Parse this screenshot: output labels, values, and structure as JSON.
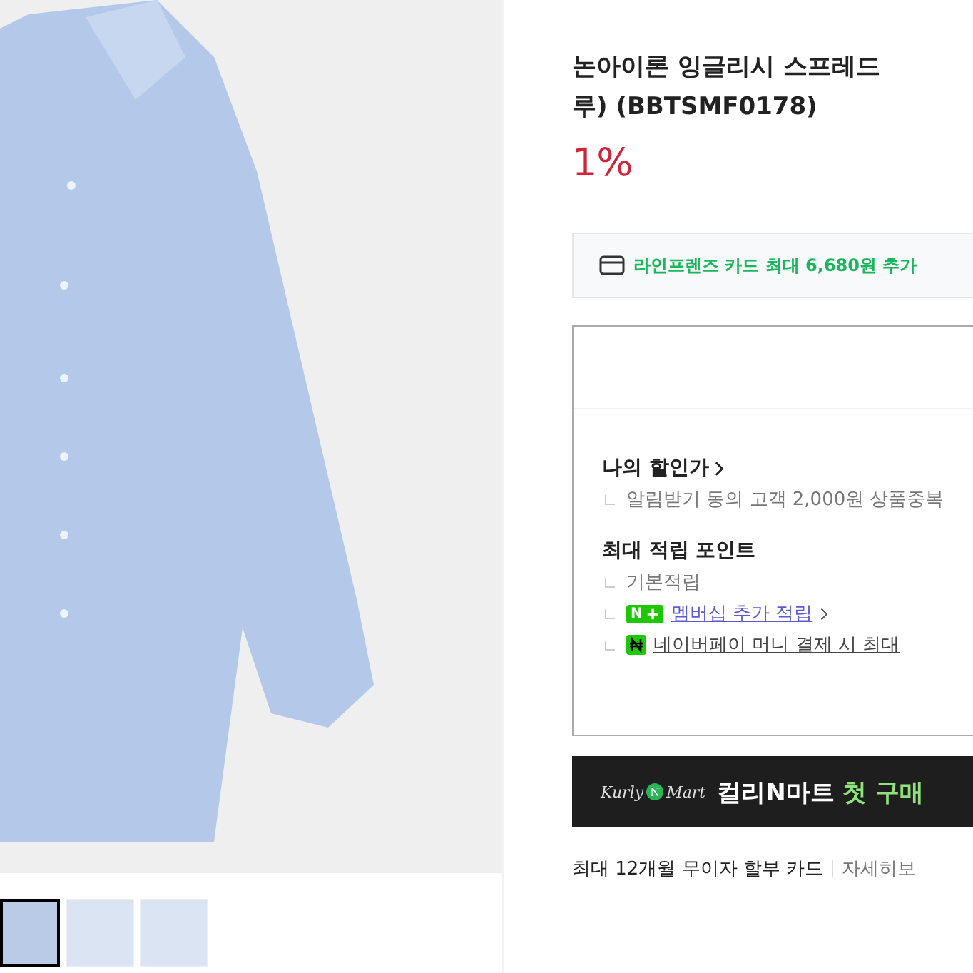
{
  "gallery": {
    "thumbnails": [
      {
        "selected": true
      },
      {
        "selected": false
      },
      {
        "selected": false
      }
    ]
  },
  "product": {
    "title_lines": [
      "논아이론 잉글리시 스프레드",
      "루) (BBTSMF0178)"
    ],
    "discount": "1%"
  },
  "card_notice": "라인프렌즈 카드 최대 6,680원 추가",
  "benefits": {
    "my_price": {
      "title": "나의 할인가",
      "items": [
        "알림받기 동의 고객 2,000원 상품중복"
      ]
    },
    "points": {
      "title": "최대 적립 포인트",
      "items": [
        {
          "kind": "plain",
          "text": "기본적립"
        },
        {
          "kind": "membership",
          "badge": "N",
          "text": "멤버십 추가 적립"
        },
        {
          "kind": "pay",
          "text": "네이버페이 머니 결제 시 최대"
        }
      ]
    }
  },
  "banner": {
    "logo_left": "Kurly",
    "logo_mid": "N",
    "logo_right": "Mart",
    "text": "컬리N마트",
    "highlight": "첫 구매"
  },
  "installment": {
    "text": "최대 12개월 무이자 할부 카드",
    "link": "자세히보"
  }
}
